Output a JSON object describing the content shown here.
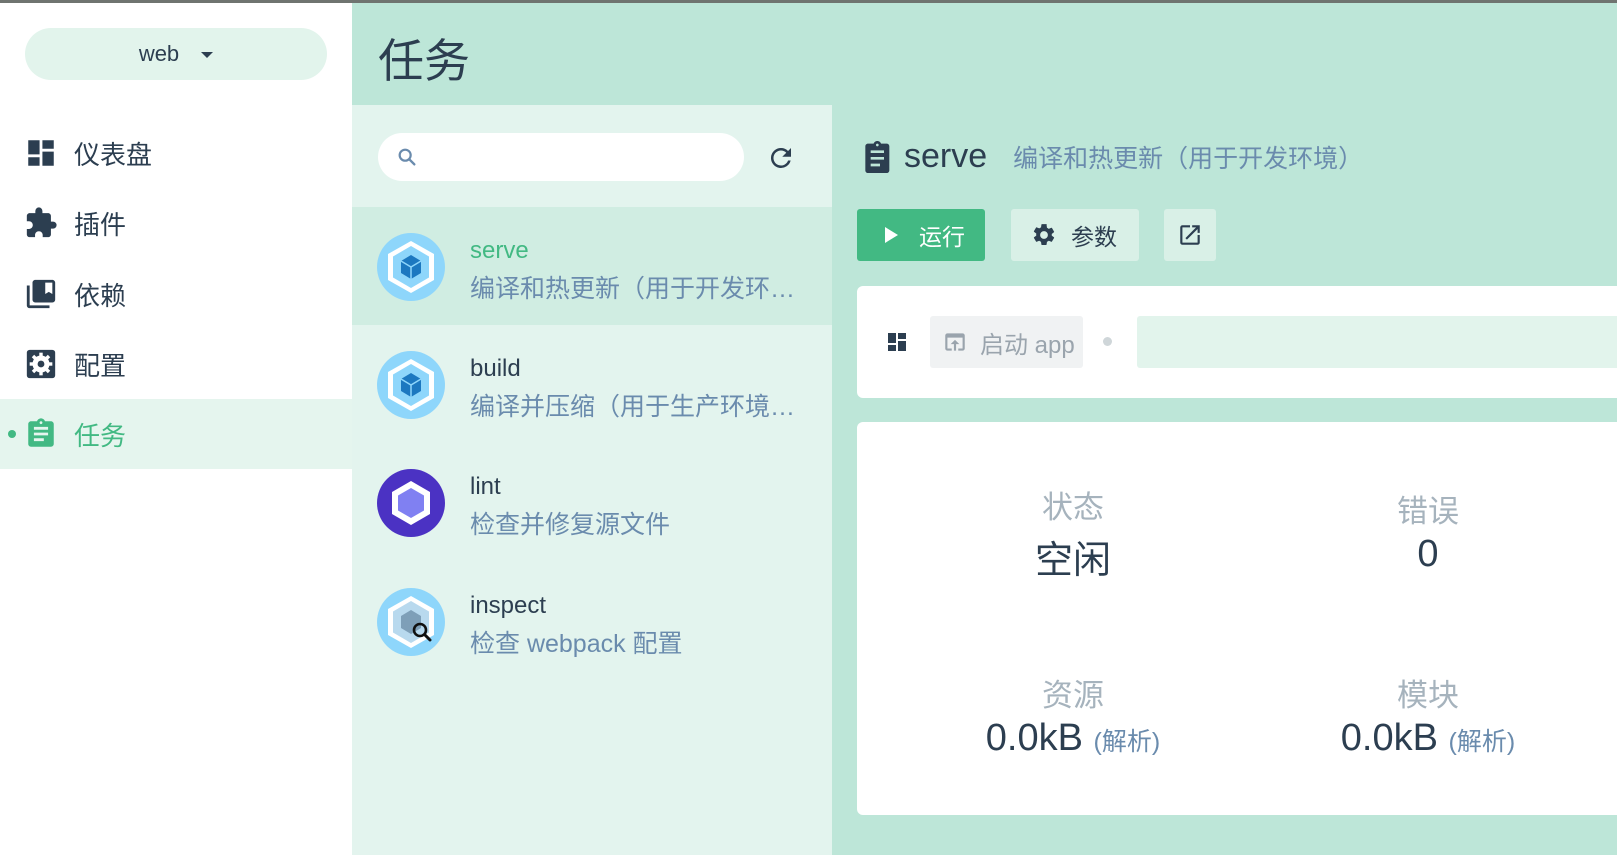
{
  "sidebar": {
    "project": "web",
    "items": [
      {
        "label": "仪表盘",
        "icon": "dashboard-icon"
      },
      {
        "label": "插件",
        "icon": "puzzle-icon"
      },
      {
        "label": "依赖",
        "icon": "library-icon"
      },
      {
        "label": "配置",
        "icon": "settings-box-icon"
      },
      {
        "label": "任务",
        "icon": "clipboard-icon",
        "active": true
      }
    ]
  },
  "header": {
    "title": "任务"
  },
  "task_list": {
    "search_placeholder": "",
    "tasks": [
      {
        "name": "serve",
        "description": "编译和热更新（用于开发环…",
        "icon": "webpack-icon",
        "selected": true
      },
      {
        "name": "build",
        "description": "编译并压缩（用于生产环境…",
        "icon": "webpack-icon"
      },
      {
        "name": "lint",
        "description": "检查并修复源文件",
        "icon": "eslint-icon"
      },
      {
        "name": "inspect",
        "description": "检查 webpack 配置",
        "icon": "webpack-inspect-icon"
      }
    ]
  },
  "detail": {
    "name": "serve",
    "description": "编译和热更新（用于开发环境）",
    "run_label": "运行",
    "params_label": "参数",
    "launch_label": "启动 app",
    "url_value": "",
    "stats": {
      "status_label": "状态",
      "status_value": "空闲",
      "errors_label": "错误",
      "errors_value": "0",
      "assets_label": "资源",
      "assets_value": "0.0kB",
      "assets_sub": "(解析)",
      "modules_label": "模块",
      "modules_value": "0.0kB",
      "modules_sub": "(解析)"
    }
  },
  "colors": {
    "accent": "#42b983",
    "header_bg": "#bde6d8",
    "panel_bg": "#e3f4ee",
    "text": "#2c3e50",
    "muted": "#6a8bad"
  }
}
